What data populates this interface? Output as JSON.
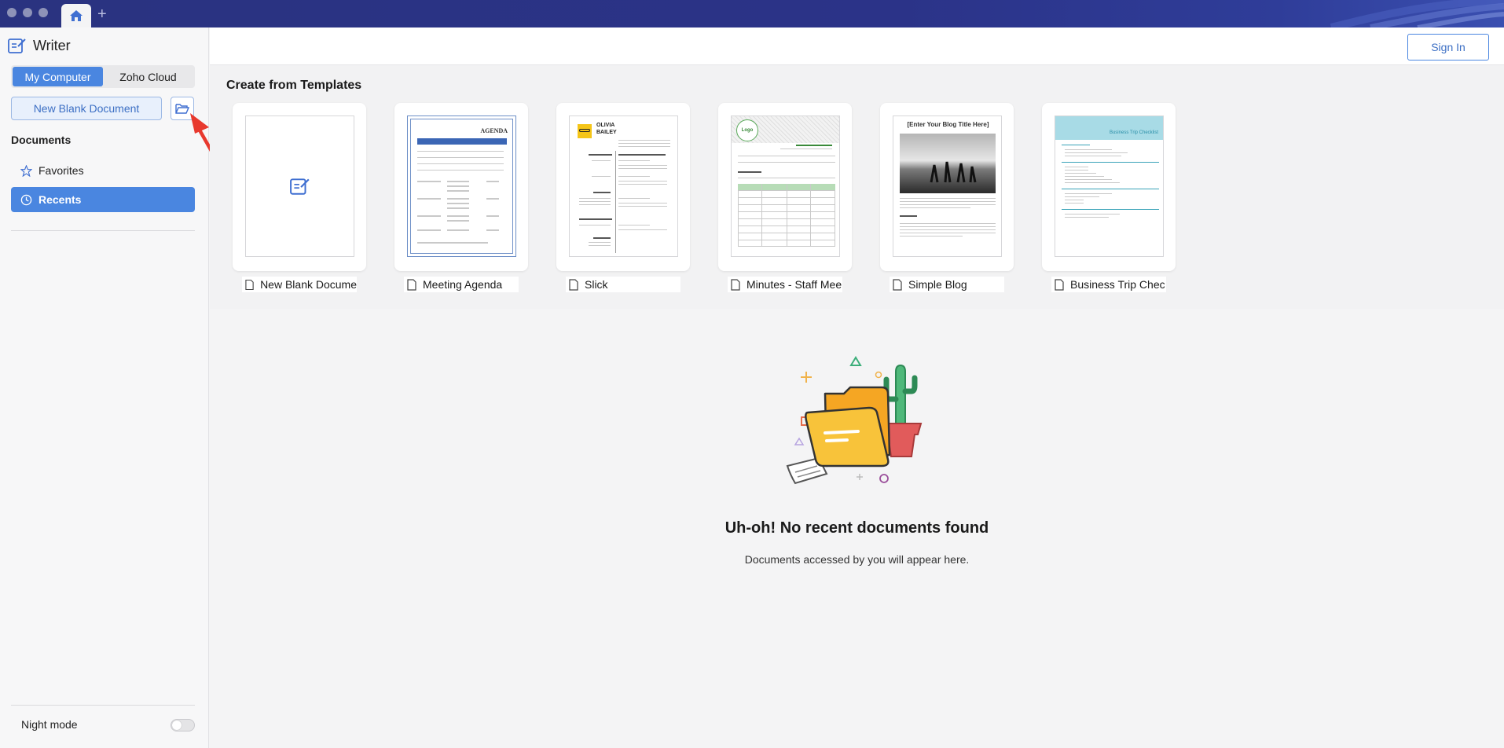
{
  "app": {
    "name": "Writer"
  },
  "titlebar": {
    "add_tab": "+"
  },
  "sidebar": {
    "storage_tabs": [
      {
        "label": "My Computer",
        "active": true
      },
      {
        "label": "Zoho Cloud",
        "active": false
      }
    ],
    "new_blank_label": "New Blank Document",
    "documents_title": "Documents",
    "nav": [
      {
        "label": "Favorites",
        "icon": "star-icon",
        "active": false
      },
      {
        "label": "Recents",
        "icon": "clock-icon",
        "active": true
      }
    ],
    "night_mode_label": "Night mode",
    "night_mode_on": false
  },
  "header": {
    "sign_in_label": "Sign In"
  },
  "templates": {
    "title": "Create from Templates",
    "items": [
      {
        "label": "New Blank Docume"
      },
      {
        "label": "Meeting Agenda"
      },
      {
        "label": "Slick"
      },
      {
        "label": "Minutes - Staff Mee"
      },
      {
        "label": "Simple Blog"
      },
      {
        "label": "Business Trip Chec"
      }
    ],
    "thumb_text": {
      "agenda": "AGENDA",
      "slick_first": "OLIVIA",
      "slick_last": "BAILEY",
      "minutes_logo": "Logo",
      "blog_title": "[Enter Your Blog Title Here]",
      "trip": "Business Trip Checklist"
    }
  },
  "empty_state": {
    "title": "Uh-oh! No recent documents found",
    "subtitle": "Documents accessed by you will appear here."
  },
  "colors": {
    "accent": "#4a86e0",
    "titlebar": "#2a3380",
    "folder": "#f8c33a"
  }
}
